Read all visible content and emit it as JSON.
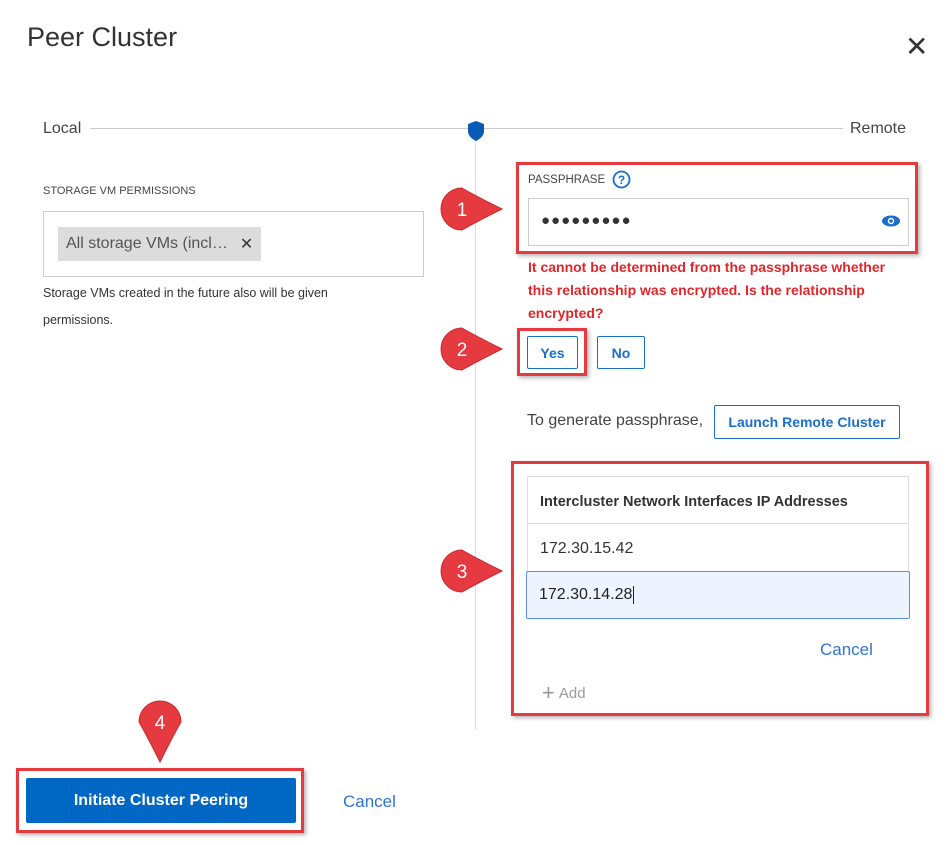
{
  "dialog": {
    "title": "Peer Cluster",
    "close_icon": "close-icon"
  },
  "slider": {
    "left_label": "Local",
    "right_label": "Remote"
  },
  "local": {
    "permissions_label": "STORAGE VM PERMISSIONS",
    "chip_label": "All storage VMs (incl…",
    "help_line1": "Storage VMs created in the future also will be given",
    "help_line2": "permissions."
  },
  "remote": {
    "passphrase_label": "PASSPHRASE",
    "passphrase_value": "●●●●●●●●●",
    "error_line1": "It cannot be determined from the passphrase whether",
    "error_line2": "this relationship was encrypted. Is the relationship",
    "error_line3": "encrypted?",
    "yes_label": "Yes",
    "no_label": "No",
    "generate_text": "To generate passphrase,",
    "launch_label": "Launch Remote Cluster",
    "table_header": "Intercluster Network Interfaces IP Addresses",
    "ip_rows": [
      "172.30.15.42"
    ],
    "ip_input_value": "172.30.14.28",
    "cancel_label": "Cancel",
    "add_label": "Add"
  },
  "footer": {
    "initiate_label": "Initiate Cluster Peering",
    "cancel_label": "Cancel"
  },
  "callouts": [
    "1",
    "2",
    "3",
    "4"
  ],
  "colors": {
    "accent": "#0067c5",
    "error": "#e0262b",
    "annotation": "#e53a40"
  }
}
